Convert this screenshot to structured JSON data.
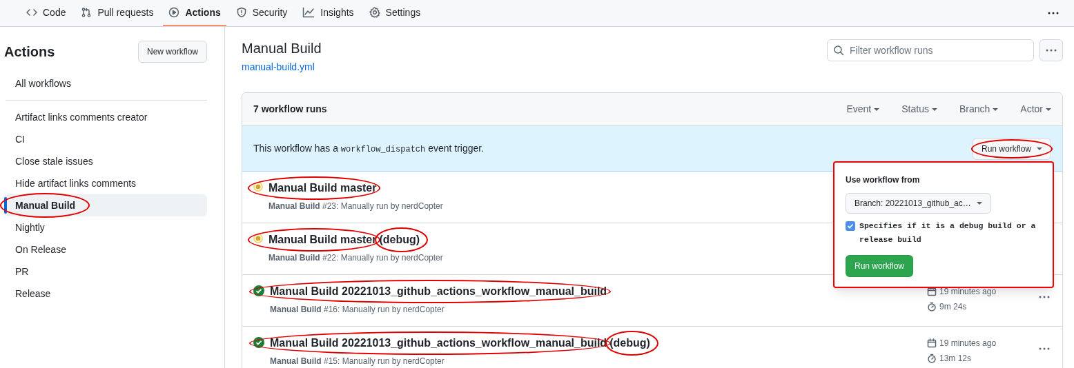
{
  "nav": {
    "tabs": [
      {
        "label": "Code",
        "selected": false
      },
      {
        "label": "Pull requests",
        "selected": false
      },
      {
        "label": "Actions",
        "selected": true
      },
      {
        "label": "Security",
        "selected": false
      },
      {
        "label": "Insights",
        "selected": false
      },
      {
        "label": "Settings",
        "selected": false
      }
    ]
  },
  "sidebar": {
    "title": "Actions",
    "new_button": "New workflow",
    "all_workflows": {
      "label": "All workflows",
      "selected": false
    },
    "workflows": [
      {
        "label": "Artifact links comments creator",
        "selected": false,
        "circled": false
      },
      {
        "label": "CI",
        "selected": false,
        "circled": false
      },
      {
        "label": "Close stale issues",
        "selected": false,
        "circled": false
      },
      {
        "label": "Hide artifact links comments",
        "selected": false,
        "circled": false
      },
      {
        "label": "Manual Build",
        "selected": true,
        "circled": true
      },
      {
        "label": "Nightly",
        "selected": false,
        "circled": false
      },
      {
        "label": "On Release",
        "selected": false,
        "circled": false
      },
      {
        "label": "PR",
        "selected": false,
        "circled": false
      },
      {
        "label": "Release",
        "selected": false,
        "circled": false
      }
    ]
  },
  "header": {
    "title": "Manual Build",
    "file_link": "manual-build.yml",
    "filter_placeholder": "Filter workflow runs"
  },
  "runs_box": {
    "count": "7 workflow runs",
    "filters": [
      "Event",
      "Status",
      "Branch",
      "Actor"
    ],
    "banner": {
      "text_before": "This workflow has a",
      "code": "workflow_dispatch",
      "text_after": "event trigger.",
      "button": "Run workflow",
      "button_circled": true
    },
    "popup": {
      "highlighted": true,
      "heading": "Use workflow from",
      "branch": "Branch: 20221013_github_ac…",
      "checkbox_label": "Specifies if it is a debug build or a release build",
      "checked": true,
      "run_button": "Run workflow"
    },
    "runs": [
      {
        "kind": "in_progress",
        "title": "Manual Build master",
        "title_circled": true,
        "meta": "**Manual Build** #23: Manually run by nerdCopter"
      },
      {
        "kind": "in_progress",
        "title": "Manual Build master",
        "suffix": "(debug)",
        "title_circled": true,
        "suffix_circled": true,
        "meta": "**Manual Build** #22: Manually run by nerdCopter"
      },
      {
        "kind": "success",
        "title": "Manual Build 20221013_github_actions_workflow_manual_build",
        "title_circled": true,
        "meta": "**Manual Build** #16: Manually run by nerdCopter",
        "when": "19 minutes ago",
        "duration": "9m 24s"
      },
      {
        "kind": "success",
        "title": "Manual Build 20221013_github_actions_workflow_manual_build",
        "suffix": "(debug)",
        "title_circled": true,
        "suffix_circled": true,
        "meta": "**Manual Build** #15: Manually run by nerdCopter",
        "when": "19 minutes ago",
        "duration": "13m 12s"
      }
    ]
  }
}
